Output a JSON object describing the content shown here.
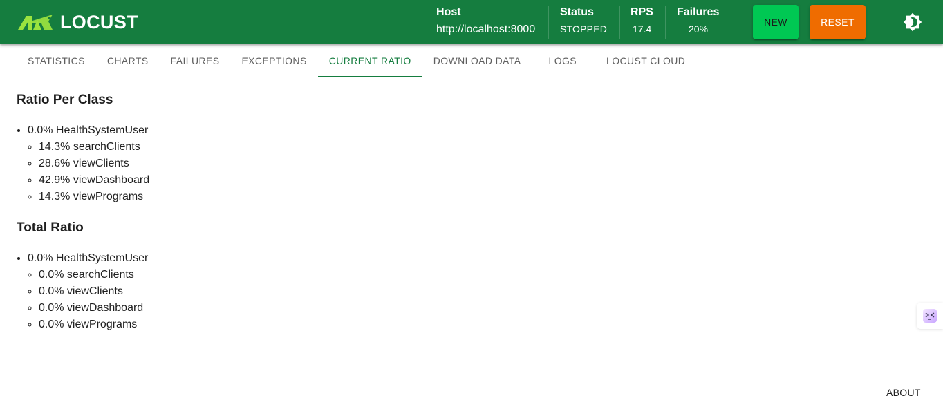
{
  "header": {
    "logo_text": "LOCUST",
    "host": {
      "label": "Host",
      "value": "http://localhost:8000"
    },
    "status": {
      "label": "Status",
      "value": "STOPPED"
    },
    "rps": {
      "label": "RPS",
      "value": "17.4"
    },
    "failures": {
      "label": "Failures",
      "value": "20%"
    },
    "new_label": "NEW",
    "reset_label": "RESET",
    "theme_icon": "brightness-icon",
    "colors": {
      "header_bg": "#157d3f",
      "new_bg": "#00c853",
      "reset_bg": "#ef6c00",
      "logo_accent": "#9be33f"
    }
  },
  "tabs": [
    {
      "label": "STATISTICS"
    },
    {
      "label": "CHARTS"
    },
    {
      "label": "FAILURES"
    },
    {
      "label": "EXCEPTIONS"
    },
    {
      "label": "CURRENT RATIO",
      "active": true
    },
    {
      "label": "DOWNLOAD DATA"
    },
    {
      "label": "LOGS"
    },
    {
      "label": "LOCUST CLOUD"
    }
  ],
  "ratio_per_class": {
    "title": "Ratio Per Class",
    "user": "0.0% HealthSystemUser",
    "tasks": [
      "14.3% searchClients",
      "28.6% viewClients",
      "42.9% viewDashboard",
      "14.3% viewPrograms"
    ]
  },
  "total_ratio": {
    "title": "Total Ratio",
    "user": "0.0% HealthSystemUser",
    "tasks": [
      "0.0% searchClients",
      "0.0% viewClients",
      "0.0% viewDashboard",
      "0.0% viewPrograms"
    ]
  },
  "side_widget_icon": "devtools-icon",
  "footer": {
    "about_label": "ABOUT"
  }
}
